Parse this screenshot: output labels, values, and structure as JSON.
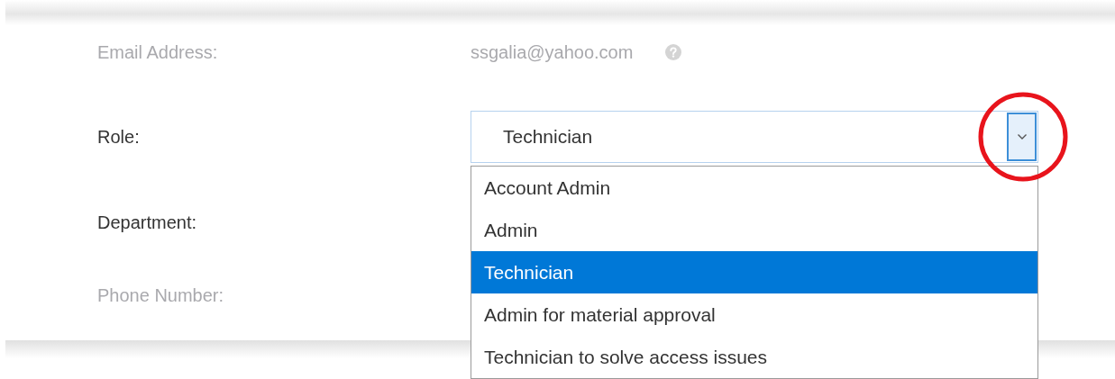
{
  "fields": [
    {
      "kind": "text",
      "label": "Email Address:",
      "value": "ssgalia@yahoo.com",
      "disabled": true,
      "help": true
    },
    {
      "kind": "select",
      "label": "Role:",
      "value": "Technician",
      "disabled": false,
      "expanded": true,
      "options": [
        {
          "label": "Account Admin",
          "selected": false
        },
        {
          "label": "Admin",
          "selected": false
        },
        {
          "label": "Technician",
          "selected": true
        },
        {
          "label": "Admin for material approval",
          "selected": false
        },
        {
          "label": "Technician to solve access issues",
          "selected": false
        }
      ]
    },
    {
      "kind": "text",
      "label": "Department:",
      "disabled": false
    },
    {
      "kind": "text",
      "label": "Phone Number:",
      "disabled": true
    }
  ]
}
